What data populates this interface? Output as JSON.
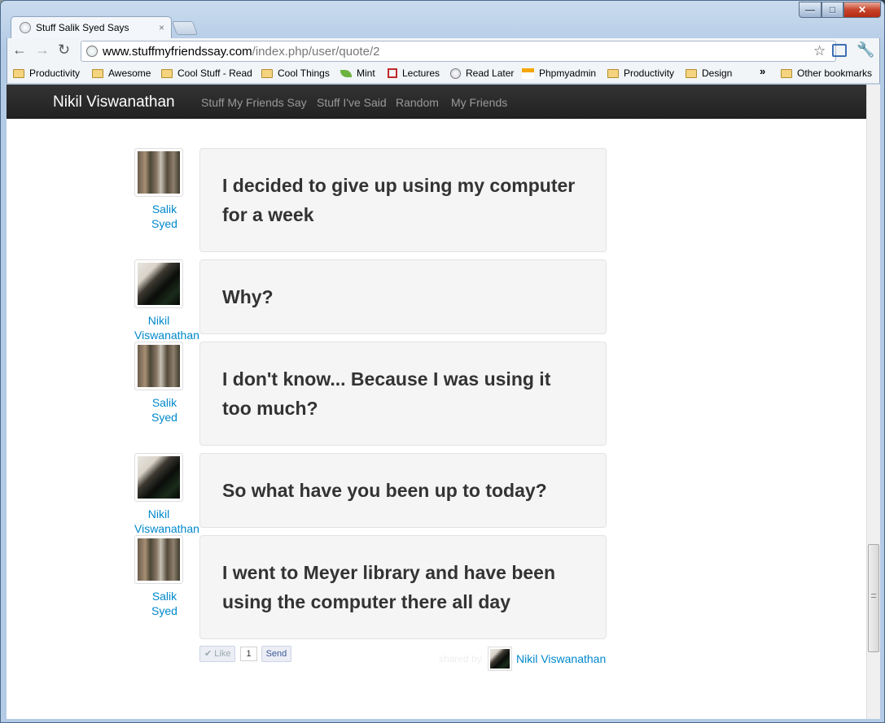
{
  "browser": {
    "tab_title": "Stuff Salik Syed Says",
    "tab_close": "×",
    "url_host": "www.stuffmyfriendssay.com",
    "url_path": "/index.php/user/quote/2",
    "back": "←",
    "forward": "→",
    "reload": "↻",
    "star": "☆",
    "wrench": "🔧",
    "window_min": "—",
    "window_max": "□",
    "window_close": "✕"
  },
  "bookmarks": {
    "items": [
      {
        "label": "Productivity",
        "icon": "folder-icon"
      },
      {
        "label": "Awesome",
        "icon": "folder-icon"
      },
      {
        "label": "Cool Stuff - Read",
        "icon": "folder-icon"
      },
      {
        "label": "Cool Things",
        "icon": "folder-icon"
      },
      {
        "label": "Mint",
        "icon": "mint-leaf-icon"
      },
      {
        "label": "Lectures",
        "icon": "lectures-icon"
      },
      {
        "label": "Read Later",
        "icon": "globe-icon"
      },
      {
        "label": "Phpmyadmin",
        "icon": "phpmyadmin-icon"
      },
      {
        "label": "Productivity",
        "icon": "folder-icon"
      },
      {
        "label": "Design",
        "icon": "folder-icon"
      }
    ],
    "overflow": "»",
    "other": "Other bookmarks"
  },
  "navbar": {
    "brand": "Nikil Viswanathan",
    "links": [
      "Stuff My Friends Say",
      "Stuff I've Said",
      "Random",
      "My Friends"
    ]
  },
  "quotes": [
    {
      "user_first": "Salik",
      "user_last": "Syed",
      "text": "I decided to give up using my computer for a week"
    },
    {
      "user_first": "Nikil",
      "user_last": "Viswanathan",
      "text": "Why?"
    },
    {
      "user_first": "Salik",
      "user_last": "Syed",
      "text": "I don't know... Because I was using it too much?"
    },
    {
      "user_first": "Nikil",
      "user_last": "Viswanathan",
      "text": "So what have you been up to today?"
    },
    {
      "user_first": "Salik",
      "user_last": "Syed",
      "text": "I went to Meyer library and have been using the computer there all day"
    }
  ],
  "footer": {
    "like_label": "✔ Like",
    "like_count": "1",
    "send_label": "Send",
    "shared_by": "shared by",
    "shared_name": "Nikil Viswanathan"
  }
}
